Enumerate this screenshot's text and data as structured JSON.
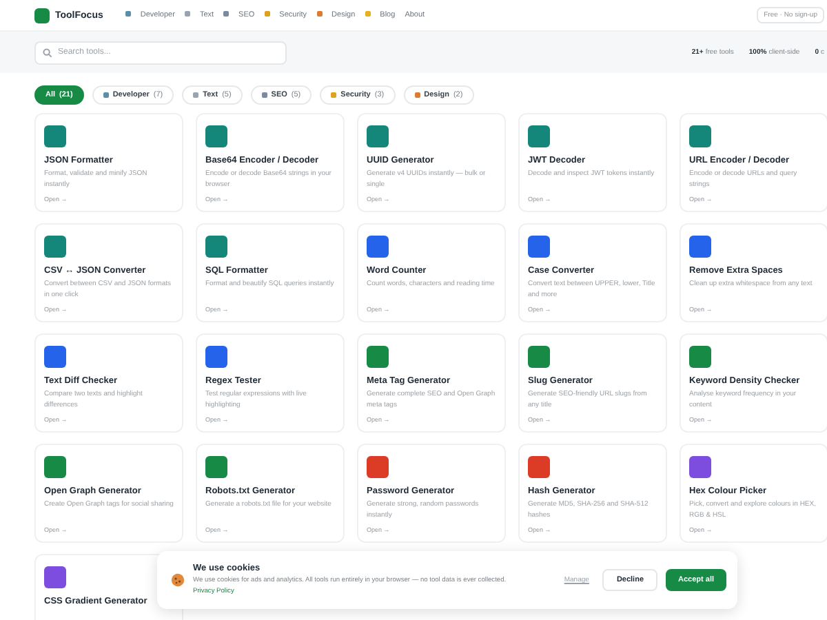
{
  "header": {
    "logo": "ToolFocus",
    "nav": [
      {
        "label": "Developer",
        "color": "#5b8fa8"
      },
      {
        "label": "Text",
        "color": "#9aa4b0"
      },
      {
        "label": "SEO",
        "color": "#7a8aa0"
      },
      {
        "label": "Security",
        "color": "#e0a020"
      },
      {
        "label": "Design",
        "color": "#e07a30"
      },
      {
        "label": "Blog",
        "color": "#e8b020"
      },
      {
        "label": "About"
      }
    ],
    "badge": "Free · No sign-up"
  },
  "search": {
    "placeholder": "Search tools..."
  },
  "stats": [
    {
      "value": "21+",
      "label": "free tools"
    },
    {
      "value": "100%",
      "label": "client-side"
    },
    {
      "value": "0",
      "label": "c"
    }
  ],
  "filters": [
    {
      "label": "All",
      "count": "(21)",
      "selected": true
    },
    {
      "label": "Developer",
      "count": "(7)",
      "selected": false,
      "color": "#5b8fa8"
    },
    {
      "label": "Text",
      "count": "(5)",
      "selected": false,
      "color": "#9aa4b0"
    },
    {
      "label": "SEO",
      "count": "(5)",
      "selected": false,
      "color": "#7a8aa0"
    },
    {
      "label": "Security",
      "count": "(3)",
      "selected": false,
      "color": "#e0a020"
    },
    {
      "label": "Design",
      "count": "(2)",
      "selected": false,
      "color": "#e07a30"
    }
  ],
  "tools": [
    {
      "title": "JSON Formatter",
      "description": "Format, validate and minify JSON instantly",
      "link": "Open →",
      "color": "#14877a"
    },
    {
      "title": "Base64 Encoder / Decoder",
      "description": "Encode or decode Base64 strings in your browser",
      "link": "Open →",
      "color": "#14877a"
    },
    {
      "title": "UUID Generator",
      "description": "Generate v4 UUIDs instantly — bulk or single",
      "link": "Open →",
      "color": "#14877a"
    },
    {
      "title": "JWT Decoder",
      "description": "Decode and inspect JWT tokens instantly",
      "link": "Open →",
      "color": "#14877a"
    },
    {
      "title": "URL Encoder / Decoder",
      "description": "Encode or decode URLs and query strings",
      "link": "Open →",
      "color": "#14877a"
    },
    {
      "title": "CSV ↔ JSON Converter",
      "description": "Convert between CSV and JSON formats in one click",
      "link": "Open →",
      "color": "#14877a"
    },
    {
      "title": "SQL Formatter",
      "description": "Format and beautify SQL queries instantly",
      "link": "Open →",
      "color": "#14877a"
    },
    {
      "title": "Word Counter",
      "description": "Count words, characters and reading time",
      "link": "Open →",
      "color": "#2563eb"
    },
    {
      "title": "Case Converter",
      "description": "Convert text between UPPER, lower, Title and more",
      "link": "Open →",
      "color": "#2563eb"
    },
    {
      "title": "Remove Extra Spaces",
      "description": "Clean up extra whitespace from any text",
      "link": "Open →",
      "color": "#2563eb"
    },
    {
      "title": "Text Diff Checker",
      "description": "Compare two texts and highlight differences",
      "link": "Open →",
      "color": "#2563eb"
    },
    {
      "title": "Regex Tester",
      "description": "Test regular expressions with live highlighting",
      "link": "Open →",
      "color": "#2563eb"
    },
    {
      "title": "Meta Tag Generator",
      "description": "Generate complete SEO and Open Graph meta tags",
      "link": "Open →",
      "color": "#178a45"
    },
    {
      "title": "Slug Generator",
      "description": "Generate SEO-friendly URL slugs from any title",
      "link": "Open →",
      "color": "#178a45"
    },
    {
      "title": "Keyword Density Checker",
      "description": "Analyse keyword frequency in your content",
      "link": "Open →",
      "color": "#178a45"
    },
    {
      "title": "Open Graph Generator",
      "description": "Create Open Graph tags for social sharing",
      "link": "Open →",
      "color": "#178a45"
    },
    {
      "title": "Robots.txt Generator",
      "description": "Generate a robots.txt file for your website",
      "link": "Open →",
      "color": "#178a45"
    },
    {
      "title": "Password Generator",
      "description": "Generate strong, random passwords instantly",
      "link": "Open →",
      "color": "#dc3b26"
    },
    {
      "title": "Hash Generator",
      "description": "Generate MD5, SHA-256 and SHA-512 hashes",
      "link": "Open →",
      "color": "#dc3b26"
    },
    {
      "title": "Hex Colour Picker",
      "description": "Pick, convert and explore colours in HEX, RGB & HSL",
      "link": "Open →",
      "color": "#7c4ddf"
    },
    {
      "title": "CSS Gradient Generator",
      "color": "#7c4ddf"
    }
  ],
  "cookie_banner": {
    "title": "We use cookies",
    "text": "We use cookies for ads and analytics. All tools run entirely in your browser — no tool data is ever collected.",
    "policy_link": "Privacy Policy",
    "manage": "Manage",
    "decline": "Decline",
    "accept": "Accept all"
  }
}
